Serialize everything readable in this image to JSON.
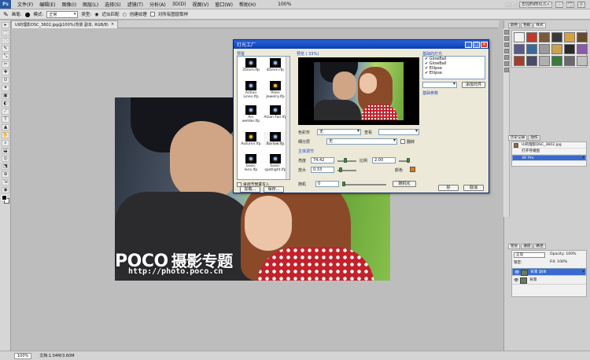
{
  "menubar": {
    "items": [
      "文件(F)",
      "编辑(E)",
      "图像(I)",
      "图层(L)",
      "选择(S)",
      "滤镜(T)",
      "分析(A)",
      "3D(D)",
      "视图(V)",
      "窗口(W)",
      "帮助(H)"
    ],
    "zoom": "100%",
    "workspace": "ESSENTIALS ▾"
  },
  "site_watermark": "思缘设计论坛 WWW.MISSYUAN.COM",
  "optionsbar": {
    "brush_label": "画笔:",
    "mode_label": "模式:",
    "mode_value": "正常",
    "type_label": "类型:",
    "opt_proximity": "近似匹配",
    "opt_texture": "创建纹理",
    "opt_sample_all": "对所有图层取样"
  },
  "document_tab": {
    "title": "UI的理影DSC_3602.jpg@100%(背景 副本, RGB/8)",
    "close": "×"
  },
  "tools": [
    "▸",
    "⬚",
    "◌",
    "✎",
    "⤡",
    "✂",
    "✚",
    "⊙",
    "✦",
    "▣",
    "◐",
    "⟋",
    "T",
    "▲",
    "✋",
    "⌕",
    "⬓",
    "◎",
    "⬔",
    "⊕",
    "⇲",
    "◉"
  ],
  "photo_watermark": {
    "brand": "POCO",
    "brand_cn": "摄影专题",
    "url": "http://photo.poco.cn"
  },
  "dialog": {
    "title": "灯光工厂",
    "presets_header": "预置",
    "presets": [
      "35mm.lfp",
      "85mm.lfp",
      "Action Lines.lfp",
      "Alien Jewelry.lfp",
      "Arc welder.lfp",
      "Asian Fan.lfp",
      "Autumn.lfp",
      "Barlow.lfp",
      "basic lens.lfp",
      "basic spotlight.lfp"
    ],
    "preset_checkbox": "将调节预置写入",
    "load_button": "加载...",
    "save_button": "保存...",
    "preview_header": "预览 ( 33%)",
    "color_model_label": "色彩形",
    "color_model_value": "无",
    "view_label": "查看",
    "view_value": "",
    "mask_label": "细分层",
    "mask_value": "无",
    "flip_label": "翻转",
    "master_header": "主体调节",
    "brightness_label": "亮度",
    "brightness_value": "74.42",
    "scale_label": "比例",
    "scale_value": "2.00",
    "zoom_label": "放大",
    "zoom_value": "0.33",
    "color_label": "颜色",
    "random_label": "随机",
    "random_value": "0",
    "randomize_button": "随机化",
    "lights_header": "基础的灯光",
    "lights": [
      "✔ GlowBall",
      "✔ GlowBall",
      "✔ Ellipse",
      "✔ Ellipse"
    ],
    "add_light_button": "添加元件",
    "props_header": "基础参数",
    "ok_button": "好",
    "cancel_button": "取消"
  },
  "right_panel": {
    "top_tabs": [
      "颜色",
      "色板",
      "样式"
    ],
    "style_colors": [
      "#f2f2f2",
      "#c23a2a",
      "#7a5a3a",
      "#3a3a3a",
      "#d8a040",
      "#6a4a2a",
      "#5a5a8a",
      "#3a6a9a",
      "#9a9a9a",
      "#caa24a",
      "#2a2a2a",
      "#8a5aaa",
      "#a04030",
      "#4a4a6a",
      "#b0b0b0",
      "#3a7a3a",
      "#6a6a6a",
      "#c0c0c0"
    ],
    "history_tabs": [
      "历史记录",
      "动作"
    ],
    "history_items": [
      "UI的理影DSC_3602.jpg",
      "打开存储图",
      "KF Pro"
    ],
    "layer_tabs": [
      "图层",
      "通道",
      "路径"
    ],
    "layer_mode": "正常",
    "opacity_label": "Opacity:",
    "opacity_value": "100%",
    "lock_label": "锁定:",
    "fill_label": "Fill:",
    "fill_value": "100%",
    "layers": [
      "背景 副本",
      "背景"
    ]
  },
  "statusbar": {
    "zoom": "100%",
    "doc_info": "文档:1.54M/3.60M"
  }
}
